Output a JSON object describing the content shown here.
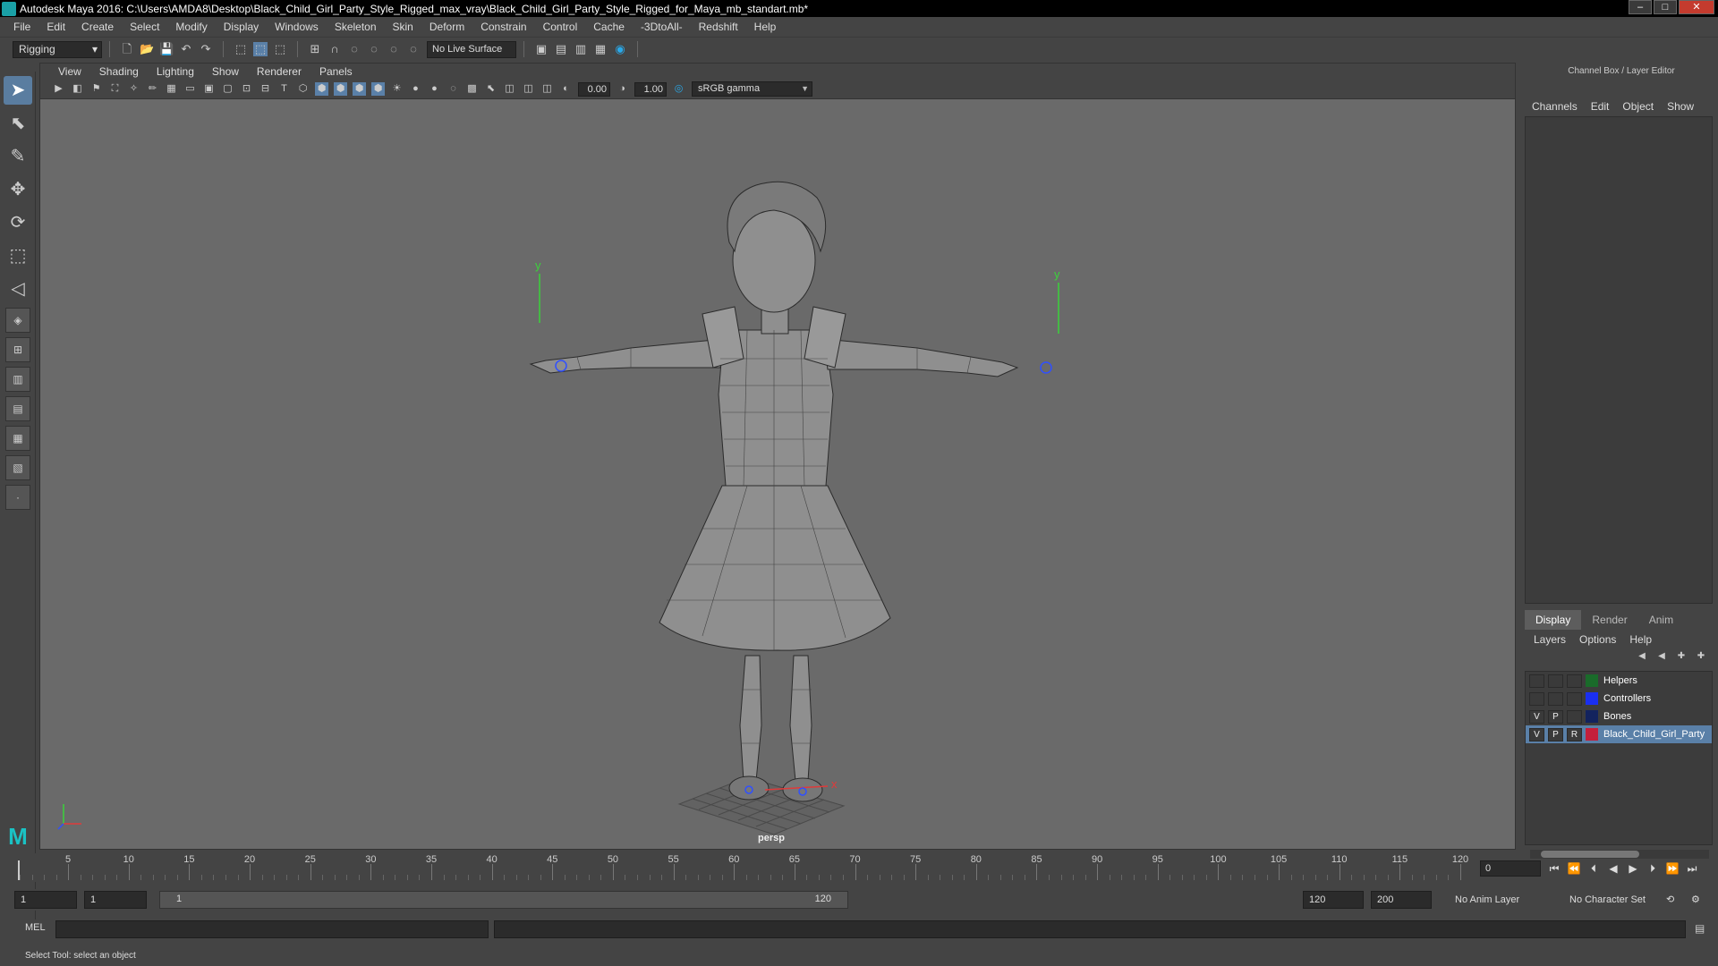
{
  "window": {
    "title": "Autodesk Maya 2016: C:\\Users\\AMDA8\\Desktop\\Black_Child_Girl_Party_Style_Rigged_max_vray\\Black_Child_Girl_Party_Style_Rigged_for_Maya_mb_standart.mb*",
    "minimize": "–",
    "maximize": "□",
    "close": "✕"
  },
  "menubar": [
    "File",
    "Edit",
    "Create",
    "Select",
    "Modify",
    "Display",
    "Windows",
    "Skeleton",
    "Skin",
    "Deform",
    "Constrain",
    "Control",
    "Cache",
    "-3DtoAll-",
    "Redshift",
    "Help"
  ],
  "statusline": {
    "mode": "Rigging",
    "live_surface": "No Live Surface"
  },
  "viewport": {
    "menus": [
      "View",
      "Shading",
      "Lighting",
      "Show",
      "Renderer",
      "Panels"
    ],
    "exposure": "0.00",
    "gamma": "1.00",
    "colorspace": "sRGB gamma",
    "camera": "persp"
  },
  "channel_box": {
    "title": "Channel Box / Layer Editor",
    "tabs": [
      "Channels",
      "Edit",
      "Object",
      "Show"
    ]
  },
  "layer_editor": {
    "tabs": [
      "Display",
      "Render",
      "Anim"
    ],
    "active_tab": "Display",
    "menus": [
      "Layers",
      "Options",
      "Help"
    ],
    "layers": [
      {
        "v": "",
        "p": "",
        "r": "",
        "color": "#1a6b2a",
        "name": "Helpers",
        "selected": false
      },
      {
        "v": "",
        "p": "",
        "r": "",
        "color": "#1a2ff0",
        "name": "Controllers",
        "selected": false
      },
      {
        "v": "V",
        "p": "P",
        "r": "",
        "color": "#13235e",
        "name": "Bones",
        "selected": false
      },
      {
        "v": "V",
        "p": "P",
        "r": "R",
        "color": "#c41f3b",
        "name": "Black_Child_Girl_Party",
        "selected": true
      }
    ]
  },
  "timeline": {
    "ticks": [
      5,
      10,
      15,
      20,
      25,
      30,
      35,
      40,
      45,
      50,
      55,
      60,
      65,
      70,
      75,
      80,
      85,
      90,
      95,
      100,
      105,
      110,
      115,
      120
    ],
    "min": 1,
    "max": 120,
    "current_frame": "0"
  },
  "range": {
    "start": "1",
    "anim_start": "1",
    "slider_start": "1",
    "slider_end": "120",
    "anim_end": "120",
    "end": "200",
    "anim_layer": "No Anim Layer",
    "character_set": "No Character Set"
  },
  "command_line": {
    "label": "MEL"
  },
  "help_line": "Select Tool: select an object",
  "colors": {
    "accent": "#5a80a8",
    "viewport_bg": "#6a6a6a",
    "maya_teal": "#1ac2c4"
  }
}
